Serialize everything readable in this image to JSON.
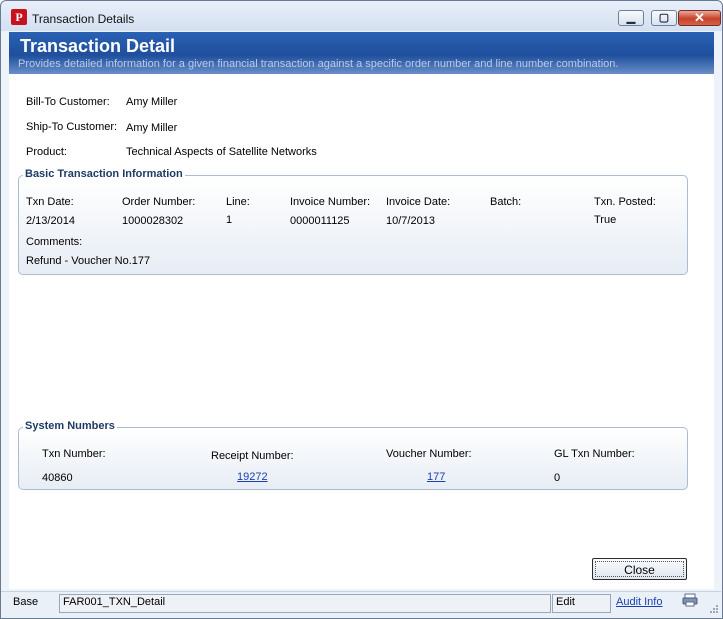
{
  "window": {
    "title": "Transaction Details",
    "app_icon_glyph": "P",
    "buttons": {
      "minimize": "▁",
      "maximize": "▢",
      "close": "✕"
    }
  },
  "header": {
    "title": "Transaction Detail",
    "subtitle": "Provides detailed information for a given financial transaction against a specific order number and line number combination."
  },
  "summary": {
    "bill_to_label": "Bill-To Customer:",
    "bill_to_value": "Amy Miller",
    "ship_to_label": "Ship-To Customer:",
    "ship_to_value": "Amy Miller",
    "product_label": "Product:",
    "product_value": "Technical Aspects of Satellite Networks"
  },
  "basic": {
    "legend": "Basic Transaction Information",
    "txn_date_label": "Txn Date:",
    "txn_date": "2/13/2014",
    "order_label": "Order Number:",
    "order": "1000028302",
    "line_label": "Line:",
    "line": "1",
    "invoice_label": "Invoice Number:",
    "invoice": "0000011125",
    "invoice_date_label": "Invoice Date:",
    "invoice_date": "10/7/2013",
    "batch_label": "Batch:",
    "batch": "",
    "posted_label": "Txn. Posted:",
    "posted": "True",
    "comments_label": "Comments:",
    "comments": "Refund - Voucher No.177"
  },
  "system": {
    "legend": "System Numbers",
    "txn_label": "Txn Number:",
    "txn": "40860",
    "receipt_label": "Receipt Number:",
    "receipt": "19272",
    "voucher_label": "Voucher Number:",
    "voucher": "177",
    "gl_label": "GL Txn Number:",
    "gl": "0"
  },
  "actions": {
    "close_label": "Close"
  },
  "status": {
    "base": "Base",
    "form": "FAR001_TXN_Detail",
    "mode": "Edit",
    "audit": "Audit Info"
  },
  "colors": {
    "header": "#1f4f9d",
    "link": "#1a3fb0",
    "legend": "#1e3b66"
  }
}
